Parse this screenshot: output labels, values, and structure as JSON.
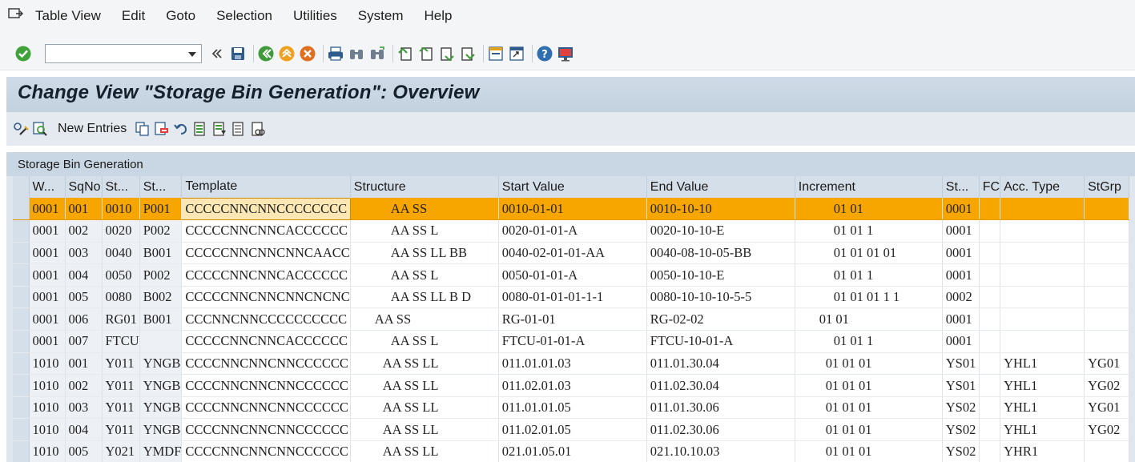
{
  "menu": {
    "items": [
      "Table View",
      "Edit",
      "Goto",
      "Selection",
      "Utilities",
      "System",
      "Help"
    ]
  },
  "toolbar": {
    "command_value": "",
    "icons": [
      "check-icon",
      "back-icon",
      "exit-icon",
      "cancel-icon",
      "save-icon",
      "print-icon",
      "find-icon",
      "find-next-icon",
      "first-page-icon",
      "previous-page-icon",
      "next-page-icon",
      "last-page-icon",
      "new-session-icon",
      "shortcut-icon",
      "help-icon",
      "customize-layout-icon"
    ]
  },
  "title": "Change View \"Storage Bin Generation\": Overview",
  "app_toolbar": {
    "new_entries_label": "New Entries"
  },
  "group_title": "Storage Bin Generation",
  "table": {
    "columns": [
      "W...",
      "SqNo",
      "St...",
      "St...",
      "Template",
      "Structure",
      "Start Value",
      "End Value",
      "Increment",
      "St...",
      "FC",
      "Acc. Type",
      "StGrp"
    ],
    "rows": [
      [
        "0001",
        "001",
        "0010",
        "P001",
        "CCCCCNNCNNCCCCCCCC",
        "AA SS",
        "0010-01-01",
        "0010-10-10",
        "01 01",
        "0001",
        "",
        "",
        ""
      ],
      [
        "0001",
        "002",
        "0020",
        "P002",
        "CCCCCNNCNNCACCCCCC",
        "AA SS L",
        "0020-01-01-A",
        "0020-10-10-E",
        "01 01 1",
        "0001",
        "",
        "",
        ""
      ],
      [
        "0001",
        "003",
        "0040",
        "B001",
        "CCCCCNNCNNCNNCAACC",
        "AA SS LL BB",
        "0040-02-01-01-AA",
        "0040-08-10-05-BB",
        "01 01 01 01",
        "0001",
        "",
        "",
        ""
      ],
      [
        "0001",
        "004",
        "0050",
        "P002",
        "CCCCCNNCNNCACCCCCC",
        "AA SS L",
        "0050-01-01-A",
        "0050-10-10-E",
        "01 01 1",
        "0001",
        "",
        "",
        ""
      ],
      [
        "0001",
        "005",
        "0080",
        "B002",
        "CCCCCNNCNNCNNCNCNC",
        "AA SS LL B D",
        "0080-01-01-01-1-1",
        "0080-10-10-10-5-5",
        "01 01 01 1 1",
        "0002",
        "",
        "",
        ""
      ],
      [
        "0001",
        "006",
        "RG01",
        "B001",
        "CCCNNCNNCCCCCCCCCC",
        "AA SS",
        "RG-01-01",
        "RG-02-02",
        "01 01",
        "0001",
        "",
        "",
        ""
      ],
      [
        "0001",
        "007",
        "FTCU",
        "",
        "CCCCCNNCNNCACCCCCC",
        "AA SS L",
        "FTCU-01-01-A",
        "FTCU-10-01-A",
        "01 01 1",
        "0001",
        "",
        "",
        ""
      ],
      [
        "1010",
        "001",
        "Y011",
        "YNGB",
        "CCCCNNCNNCNNCCCCCC",
        "AA SS LL",
        "011.01.01.03",
        "011.01.30.04",
        "01 01 01",
        "YS01",
        "",
        "YHL1",
        "YG01"
      ],
      [
        "1010",
        "002",
        "Y011",
        "YNGB",
        "CCCCNNCNNCNNCCCCCC",
        "AA SS LL",
        "011.02.01.03",
        "011.02.30.04",
        "01 01 01",
        "YS01",
        "",
        "YHL1",
        "YG02"
      ],
      [
        "1010",
        "003",
        "Y011",
        "YNGB",
        "CCCCNNCNNCNNCCCCCC",
        "AA SS LL",
        "011.01.01.05",
        "011.01.30.06",
        "01 01 01",
        "YS02",
        "",
        "YHL1",
        "YG01"
      ],
      [
        "1010",
        "004",
        "Y011",
        "YNGB",
        "CCCCNNCNNCNNCCCCCC",
        "AA SS LL",
        "011.02.01.05",
        "011.02.30.06",
        "01 01 01",
        "YS02",
        "",
        "YHL1",
        "YG02"
      ],
      [
        "1010",
        "005",
        "Y021",
        "YMDF",
        "CCCCNNCNNCNNCCCCCC",
        "AA SS LL",
        "021.01.05.01",
        "021.10.10.03",
        "01 01 01",
        "YS02",
        "",
        "YHR1",
        ""
      ]
    ]
  }
}
